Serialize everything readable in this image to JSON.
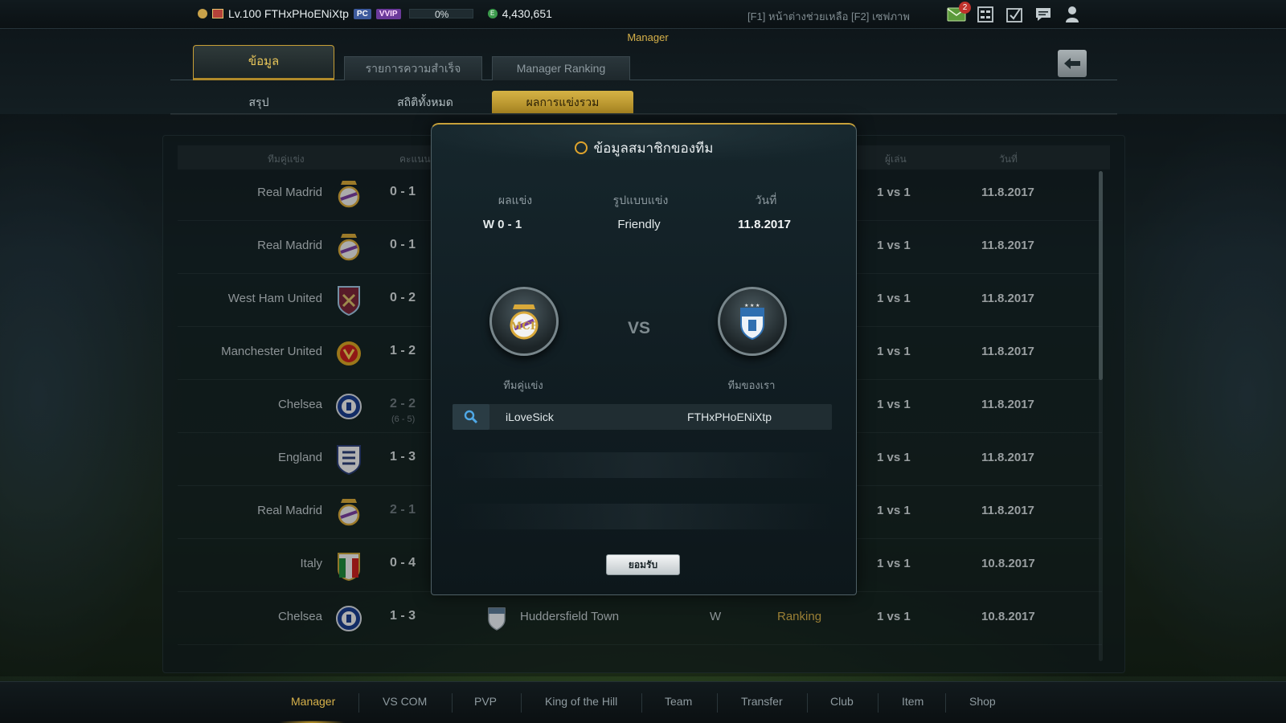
{
  "topbar": {
    "user_label": "Lv.100 FTHxPHoENiXtp",
    "pc_badge": "PC",
    "vip_badge": "VVIP",
    "xp_percent": "0%",
    "coins": "4,430,651",
    "help_text": "[F1] หน้าต่างช่วยเหลือ [F2] เซฟภาพ",
    "mail_count": "2",
    "icons": [
      "mail-icon",
      "squad-icon",
      "checklist-icon",
      "chat-icon",
      "profile-icon"
    ]
  },
  "header": {
    "section_title": "Manager",
    "tabs": [
      "ข้อมูล",
      "รายการความสำเร็จ",
      "Manager Ranking"
    ],
    "subtabs": [
      "สรุป",
      "สถิติทั้งหมด",
      "ผลการแข่งรวม"
    ]
  },
  "table": {
    "headers": {
      "opponent": "ทีมคู่แข่ง",
      "score": "คะแนน",
      "players": "ผู้เล่น",
      "date": "วันที่"
    },
    "rows": [
      {
        "team": "Real Madrid",
        "crest": "real-madrid",
        "score": "0 - 1",
        "dim": false,
        "pen": "",
        "players": "1 vs 1",
        "date": "11.8.2017"
      },
      {
        "team": "Real Madrid",
        "crest": "real-madrid",
        "score": "0 - 1",
        "dim": false,
        "pen": "",
        "players": "1 vs 1",
        "date": "11.8.2017"
      },
      {
        "team": "West Ham United",
        "crest": "west-ham",
        "score": "0 - 2",
        "dim": false,
        "pen": "",
        "players": "1 vs 1",
        "date": "11.8.2017"
      },
      {
        "team": "Manchester United",
        "crest": "man-utd",
        "score": "1 - 2",
        "dim": false,
        "pen": "",
        "players": "1 vs 1",
        "date": "11.8.2017"
      },
      {
        "team": "Chelsea",
        "crest": "chelsea",
        "score": "2 - 2",
        "dim": true,
        "pen": "(6 - 5)",
        "players": "1 vs 1",
        "date": "11.8.2017"
      },
      {
        "team": "England",
        "crest": "england",
        "score": "1 - 3",
        "dim": false,
        "pen": "",
        "players": "1 vs 1",
        "date": "11.8.2017"
      },
      {
        "team": "Real Madrid",
        "crest": "real-madrid",
        "score": "2 - 1",
        "dim": true,
        "pen": "",
        "players": "1 vs 1",
        "date": "11.8.2017"
      },
      {
        "team": "Italy",
        "crest": "italy",
        "score": "0 - 4",
        "dim": false,
        "pen": "",
        "players": "1 vs 1",
        "date": "10.8.2017"
      },
      {
        "team": "Chelsea",
        "crest": "chelsea",
        "score": "1 - 3",
        "dim": false,
        "pen": "",
        "players": "1 vs 1",
        "date": "10.8.2017",
        "own_team": "Huddersfield Town",
        "result": "W",
        "mode": "Ranking"
      }
    ]
  },
  "modal": {
    "title": "ข้อมูลสมาชิกของทีม",
    "result_label": "ผลแข่ง",
    "result_value": "W  0 - 1",
    "mode_label": "รูปแบบแข่ง",
    "mode_value": "Friendly",
    "date_label": "วันที่",
    "date_value": "11.8.2017",
    "vs": "VS",
    "opponent_label": "ทีมคู่แข่ง",
    "own_label": "ทีมของเรา",
    "opponent_name": "iLoveSick",
    "own_name": "FTHxPHoENiXtp",
    "ok_button": "ยอมรับ"
  },
  "bottomnav": {
    "items": [
      "Manager",
      "VS COM",
      "PVP",
      "King of the Hill",
      "Team",
      "Transfer",
      "Club",
      "Item",
      "Shop"
    ]
  },
  "colors": {
    "accent": "#d7b14a",
    "tab_active": "#c79f36"
  }
}
